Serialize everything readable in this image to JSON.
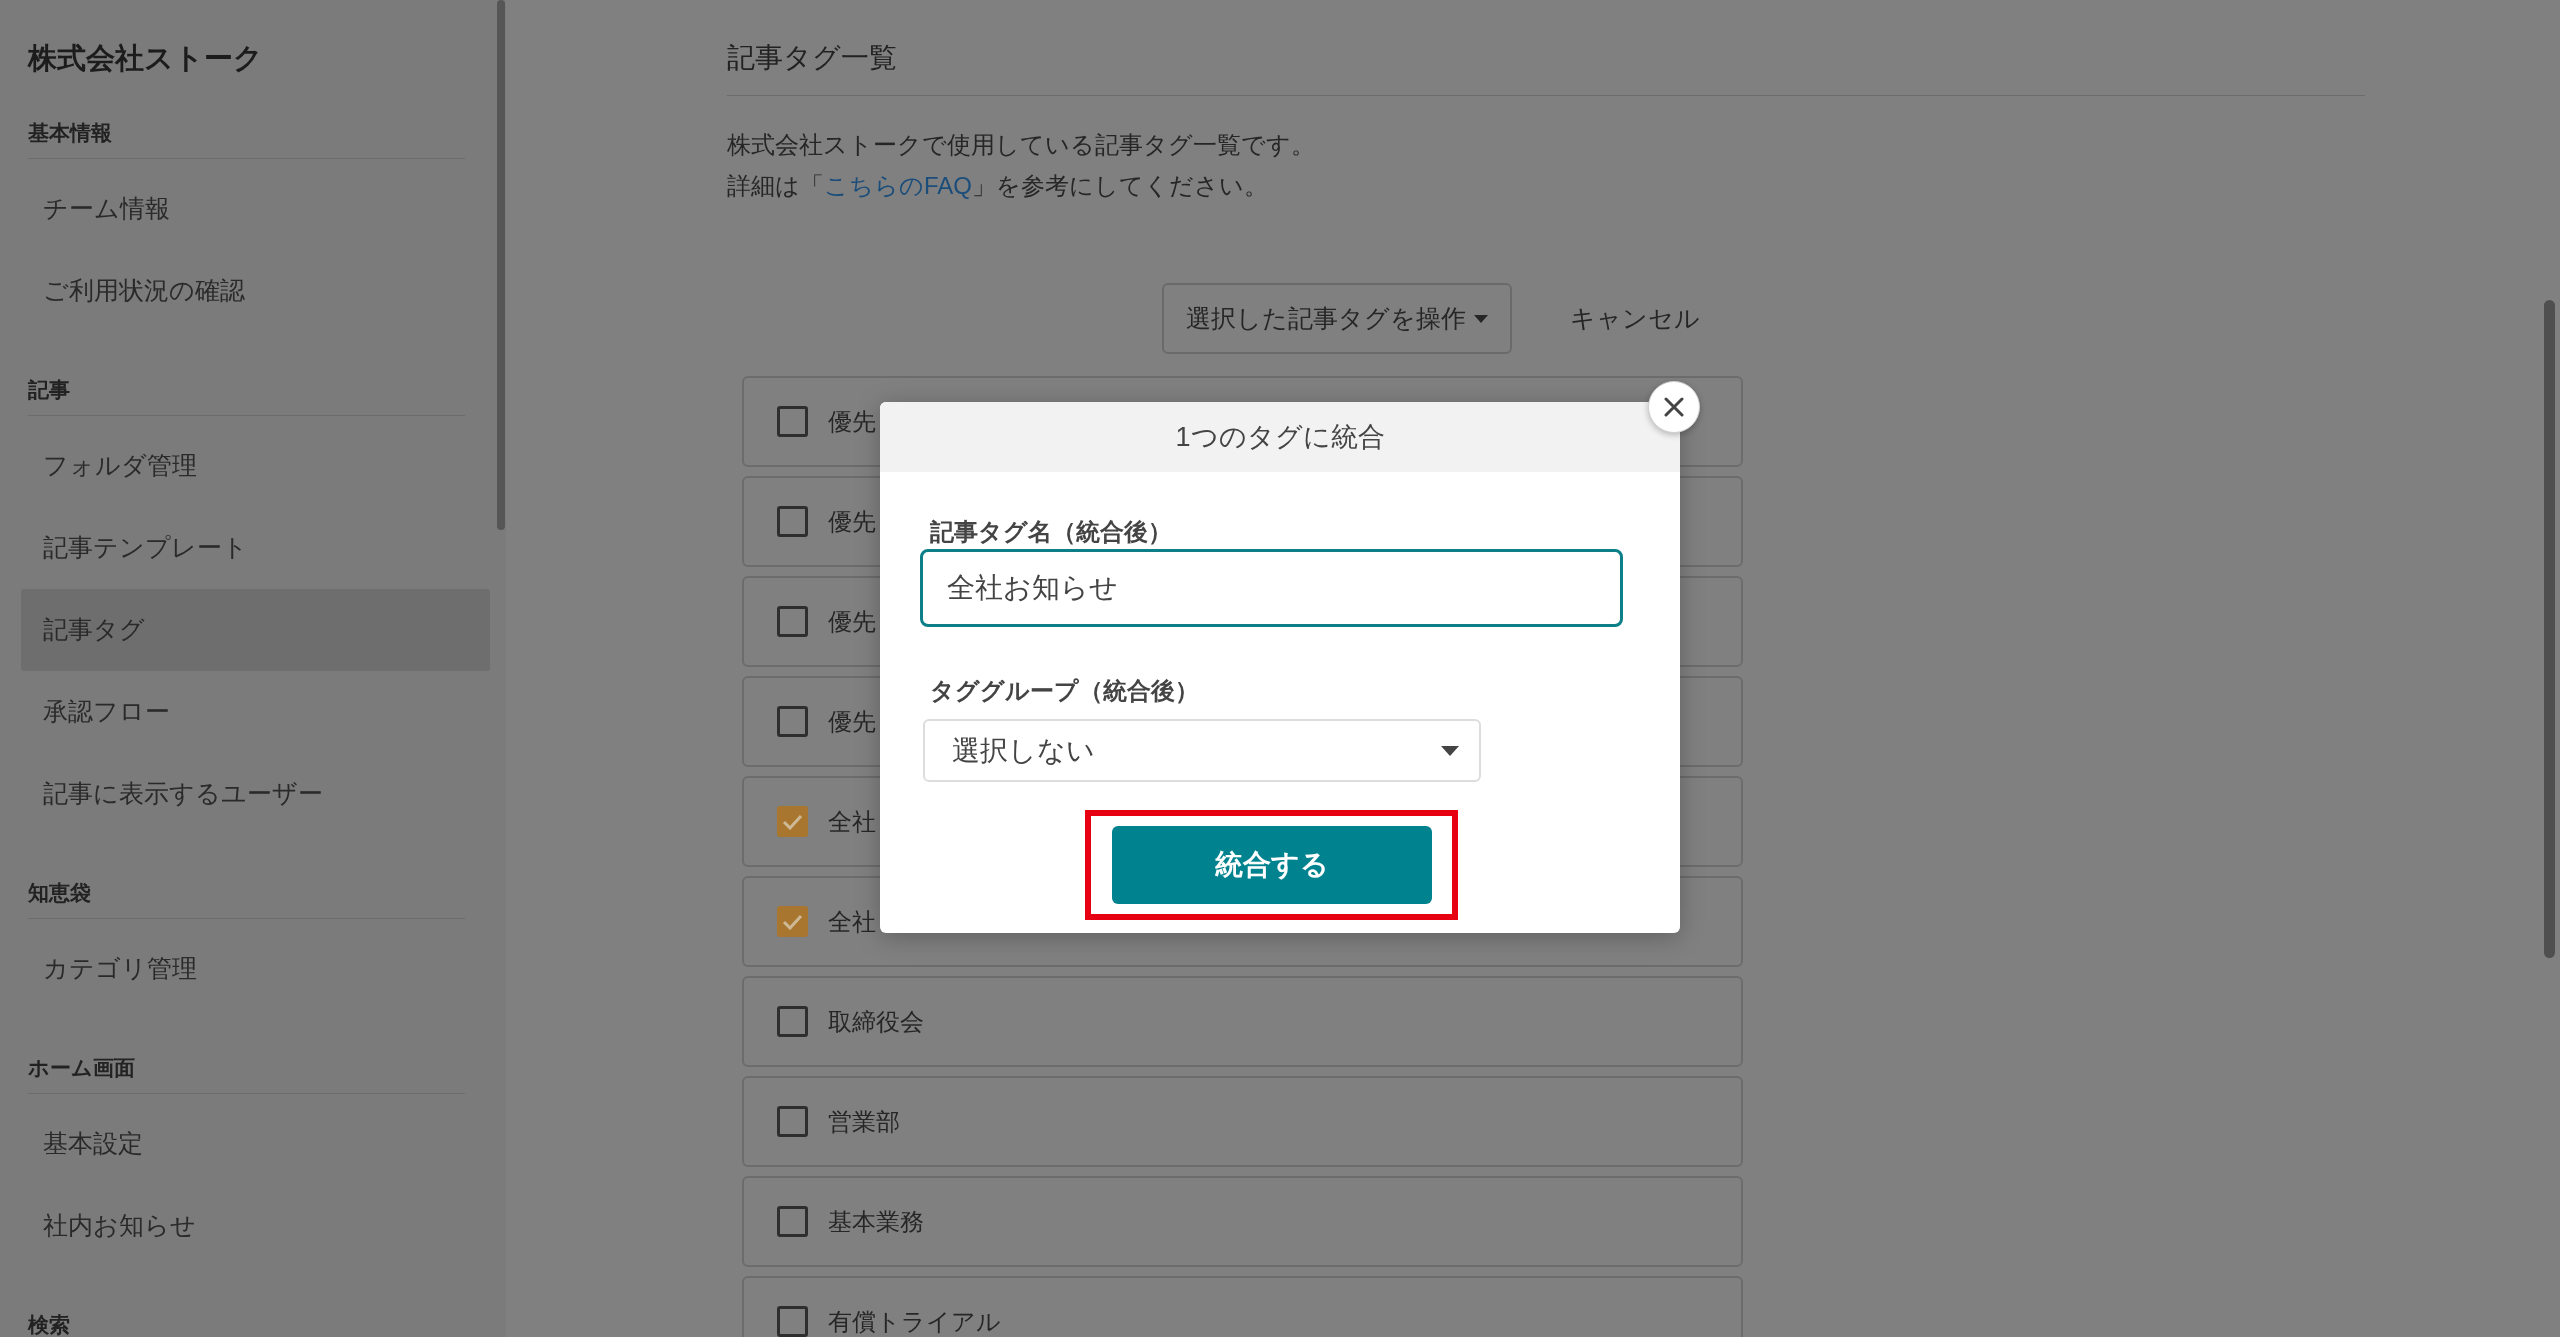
{
  "sidebar": {
    "title": "株式会社ストーク",
    "sections": [
      {
        "heading": "基本情報",
        "items": [
          {
            "label": "チーム情報",
            "selected": false
          },
          {
            "label": "ご利用状況の確認",
            "selected": false
          }
        ]
      },
      {
        "heading": "記事",
        "items": [
          {
            "label": "フォルダ管理",
            "selected": false
          },
          {
            "label": "記事テンプレート",
            "selected": false
          },
          {
            "label": "記事タグ",
            "selected": true
          },
          {
            "label": "承認フロー",
            "selected": false
          },
          {
            "label": "記事に表示するユーザー",
            "selected": false
          }
        ]
      },
      {
        "heading": "知恵袋",
        "items": [
          {
            "label": "カテゴリ管理",
            "selected": false
          }
        ]
      },
      {
        "heading": "ホーム画面",
        "items": [
          {
            "label": "基本設定",
            "selected": false
          },
          {
            "label": "社内お知らせ",
            "selected": false
          }
        ]
      },
      {
        "heading": "検索"
      }
    ]
  },
  "main": {
    "title": "記事タグ一覧",
    "description": {
      "line_1": "株式会社ストークで使用している記事タグ一覧です。",
      "line_2_before": "詳細は「",
      "link": "こちらのFAQ",
      "line_2_after": "」を参考にしてください。"
    },
    "actions": {
      "operate_button": "選択した記事タグを操作",
      "cancel_button": "キャンセル"
    },
    "tags": [
      {
        "label": "優先",
        "checked": false
      },
      {
        "label": "優先",
        "checked": false
      },
      {
        "label": "優先",
        "checked": false
      },
      {
        "label": "優先",
        "checked": false
      },
      {
        "label": "全社",
        "checked": true
      },
      {
        "label": "全社",
        "checked": true
      },
      {
        "label": "取締役会",
        "checked": false
      },
      {
        "label": "営業部",
        "checked": false
      },
      {
        "label": "基本業務",
        "checked": false
      },
      {
        "label": "有償トライアル",
        "checked": false
      }
    ]
  },
  "dialog": {
    "title": "1つのタグに統合",
    "fields": [
      {
        "kind": "text",
        "label": "記事タグ名（統合後）",
        "value": "全社お知らせ",
        "focused": true
      },
      {
        "kind": "select",
        "label": "タググループ（統合後）",
        "value": "選択しない"
      }
    ],
    "submit": {
      "label": "統合する",
      "highlighted": true
    }
  }
}
